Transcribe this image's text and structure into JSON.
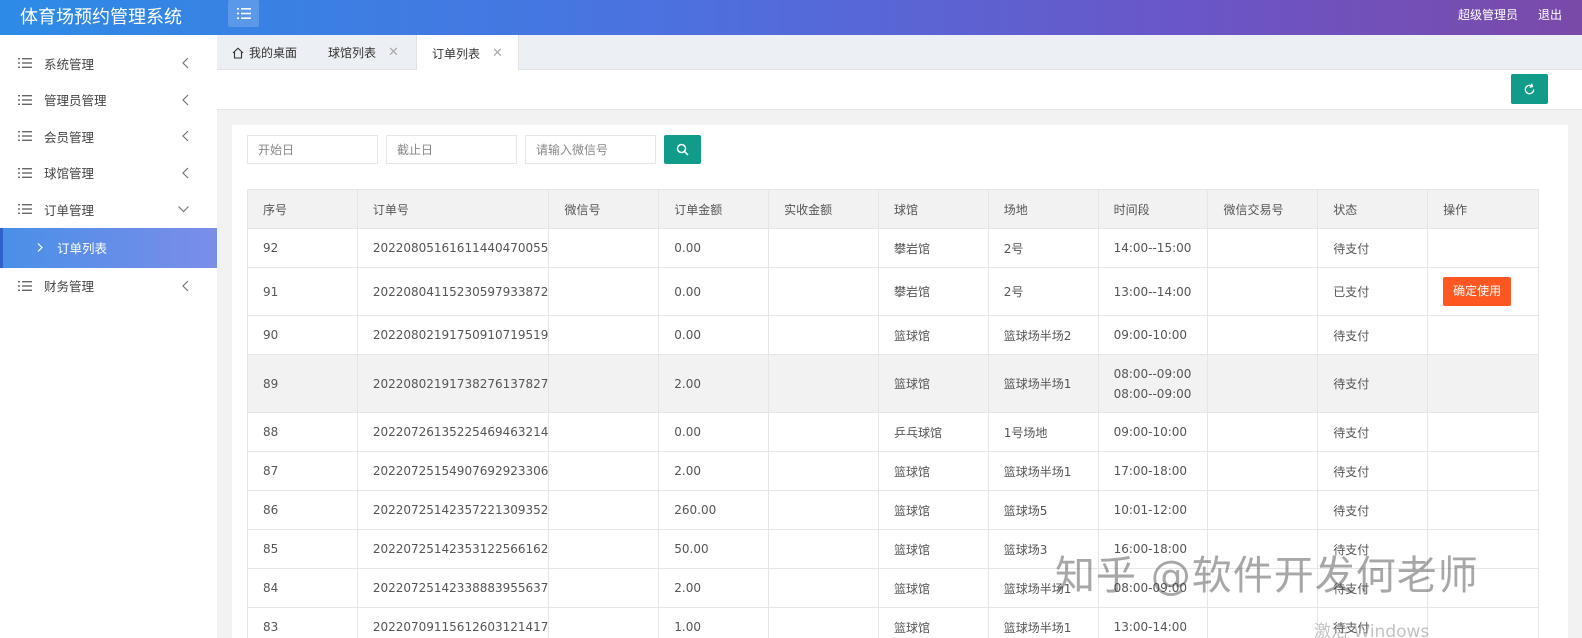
{
  "header": {
    "app_title": "体育场预约管理系统",
    "user_label": "超级管理员",
    "logout_label": "退出"
  },
  "sidebar": {
    "items": [
      {
        "label": "系统管理"
      },
      {
        "label": "管理员管理"
      },
      {
        "label": "会员管理"
      },
      {
        "label": "球馆管理"
      },
      {
        "label": "订单管理"
      },
      {
        "label": "财务管理"
      }
    ],
    "sub_item": {
      "label": "订单列表"
    }
  },
  "tabs": [
    {
      "label": "我的桌面"
    },
    {
      "label": "球馆列表"
    },
    {
      "label": "订单列表"
    }
  ],
  "filter": {
    "start_placeholder": "开始日",
    "end_placeholder": "截止日",
    "wechat_placeholder": "请输入微信号"
  },
  "table": {
    "headers": [
      "序号",
      "订单号",
      "微信号",
      "订单金额",
      "实收金额",
      "球馆",
      "场地",
      "时间段",
      "微信交易号",
      "状态",
      "操作"
    ],
    "rows": [
      {
        "id": "92",
        "order": "20220805161611440470055",
        "wechat": "",
        "amount": "0.00",
        "received": "",
        "venue": "攀岩馆",
        "court": "2号",
        "time": "14:00--15:00",
        "txn": "",
        "status": "待支付"
      },
      {
        "id": "91",
        "order": "20220804115230597933872",
        "wechat": "",
        "amount": "0.00",
        "received": "",
        "venue": "攀岩馆",
        "court": "2号",
        "time": "13:00--14:00",
        "txn": "",
        "status": "已支付",
        "action": "确定使用"
      },
      {
        "id": "90",
        "order": "20220802191750910719519",
        "wechat": "",
        "amount": "0.00",
        "received": "",
        "venue": "篮球馆",
        "court": "篮球场半场2",
        "time": "09:00-10:00",
        "txn": "",
        "status": "待支付"
      },
      {
        "id": "89",
        "order": "20220802191738276137827",
        "wechat": "",
        "amount": "2.00",
        "received": "",
        "venue": "篮球馆",
        "court": "篮球场半场1",
        "time": "08:00--09:00",
        "time2": "08:00--09:00",
        "txn": "",
        "status": "待支付"
      },
      {
        "id": "88",
        "order": "20220726135225469463214",
        "wechat": "",
        "amount": "0.00",
        "received": "",
        "venue": "乒乓球馆",
        "court": "1号场地",
        "time": "09:00-10:00",
        "txn": "",
        "status": "待支付"
      },
      {
        "id": "87",
        "order": "20220725154907692923306",
        "wechat": "",
        "amount": "2.00",
        "received": "",
        "venue": "篮球馆",
        "court": "篮球场半场1",
        "time": "17:00-18:00",
        "txn": "",
        "status": "待支付"
      },
      {
        "id": "86",
        "order": "20220725142357221309352",
        "wechat": "",
        "amount": "260.00",
        "received": "",
        "venue": "篮球馆",
        "court": "篮球场5",
        "time": "10:01-12:00",
        "txn": "",
        "status": "待支付"
      },
      {
        "id": "85",
        "order": "20220725142353122566162",
        "wechat": "",
        "amount": "50.00",
        "received": "",
        "venue": "篮球馆",
        "court": "篮球场3",
        "time": "16:00-18:00",
        "txn": "",
        "status": "待支付"
      },
      {
        "id": "84",
        "order": "20220725142338883955637",
        "wechat": "",
        "amount": "2.00",
        "received": "",
        "venue": "篮球馆",
        "court": "篮球场半场1",
        "time": "08:00-09:00",
        "txn": "",
        "status": "待支付"
      },
      {
        "id": "83",
        "order": "20220709115612603121417",
        "wechat": "",
        "amount": "1.00",
        "received": "",
        "venue": "篮球馆",
        "court": "篮球场半场1",
        "time": "13:00-14:00",
        "txn": "",
        "status": "待支付"
      }
    ]
  },
  "watermark": "知乎 @软件开发何老师",
  "os_watermark": "激活 Windows",
  "colors": {
    "primary_teal": "#119c8a",
    "action_orange": "#ff5722",
    "sidebar_active": "#5a86e8"
  }
}
